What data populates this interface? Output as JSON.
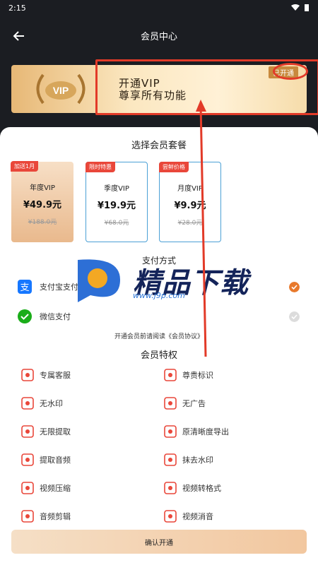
{
  "status": {
    "time": "2:15"
  },
  "header": {
    "title": "会员中心"
  },
  "banner": {
    "line1": "开通VIP",
    "line2": "尊享所有功能",
    "badge": "已开通"
  },
  "plans_section": {
    "title": "选择会员套餐"
  },
  "plans": [
    {
      "tag": "加送1月",
      "name": "年度VIP",
      "price": "¥49.9元",
      "old": "¥188.0元"
    },
    {
      "tag": "限时特惠",
      "name": "季度VIP",
      "price": "¥19.9元",
      "old": "¥68.0元"
    },
    {
      "tag": "尝鲜价格",
      "name": "月度VIP",
      "price": "¥9.9元",
      "old": "¥28.0元"
    }
  ],
  "payment": {
    "title": "支付方式",
    "alipay": "支付宝支付",
    "wechat": "微信支付"
  },
  "agreement": "开通会员前请阅读《会员协议》",
  "features_section": {
    "title": "会员特权"
  },
  "features": [
    {
      "label": "专属客服",
      "icon": "headset-icon"
    },
    {
      "label": "尊贵标识",
      "icon": "vip-mark-icon"
    },
    {
      "label": "无水印",
      "icon": "no-watermark-icon"
    },
    {
      "label": "无广告",
      "icon": "no-ads-icon"
    },
    {
      "label": "无限提取",
      "icon": "extract-icon"
    },
    {
      "label": "原清晰度导出",
      "icon": "export-icon"
    },
    {
      "label": "提取音频",
      "icon": "audio-icon"
    },
    {
      "label": "抹去水印",
      "icon": "erase-watermark-icon"
    },
    {
      "label": "视频压缩",
      "icon": "compress-icon"
    },
    {
      "label": "视频转格式",
      "icon": "convert-icon"
    },
    {
      "label": "音频剪辑",
      "icon": "audio-edit-icon"
    },
    {
      "label": "视频消音",
      "icon": "mute-icon"
    }
  ],
  "confirm": {
    "label": "确认开通"
  },
  "watermark": {
    "text": "精品下载",
    "url": "www.j9p.com"
  },
  "colors": {
    "accent": "#e9473a",
    "annotation": "#e23a28",
    "gold": "#e7b876",
    "selectedCheck": "#e8792c"
  }
}
